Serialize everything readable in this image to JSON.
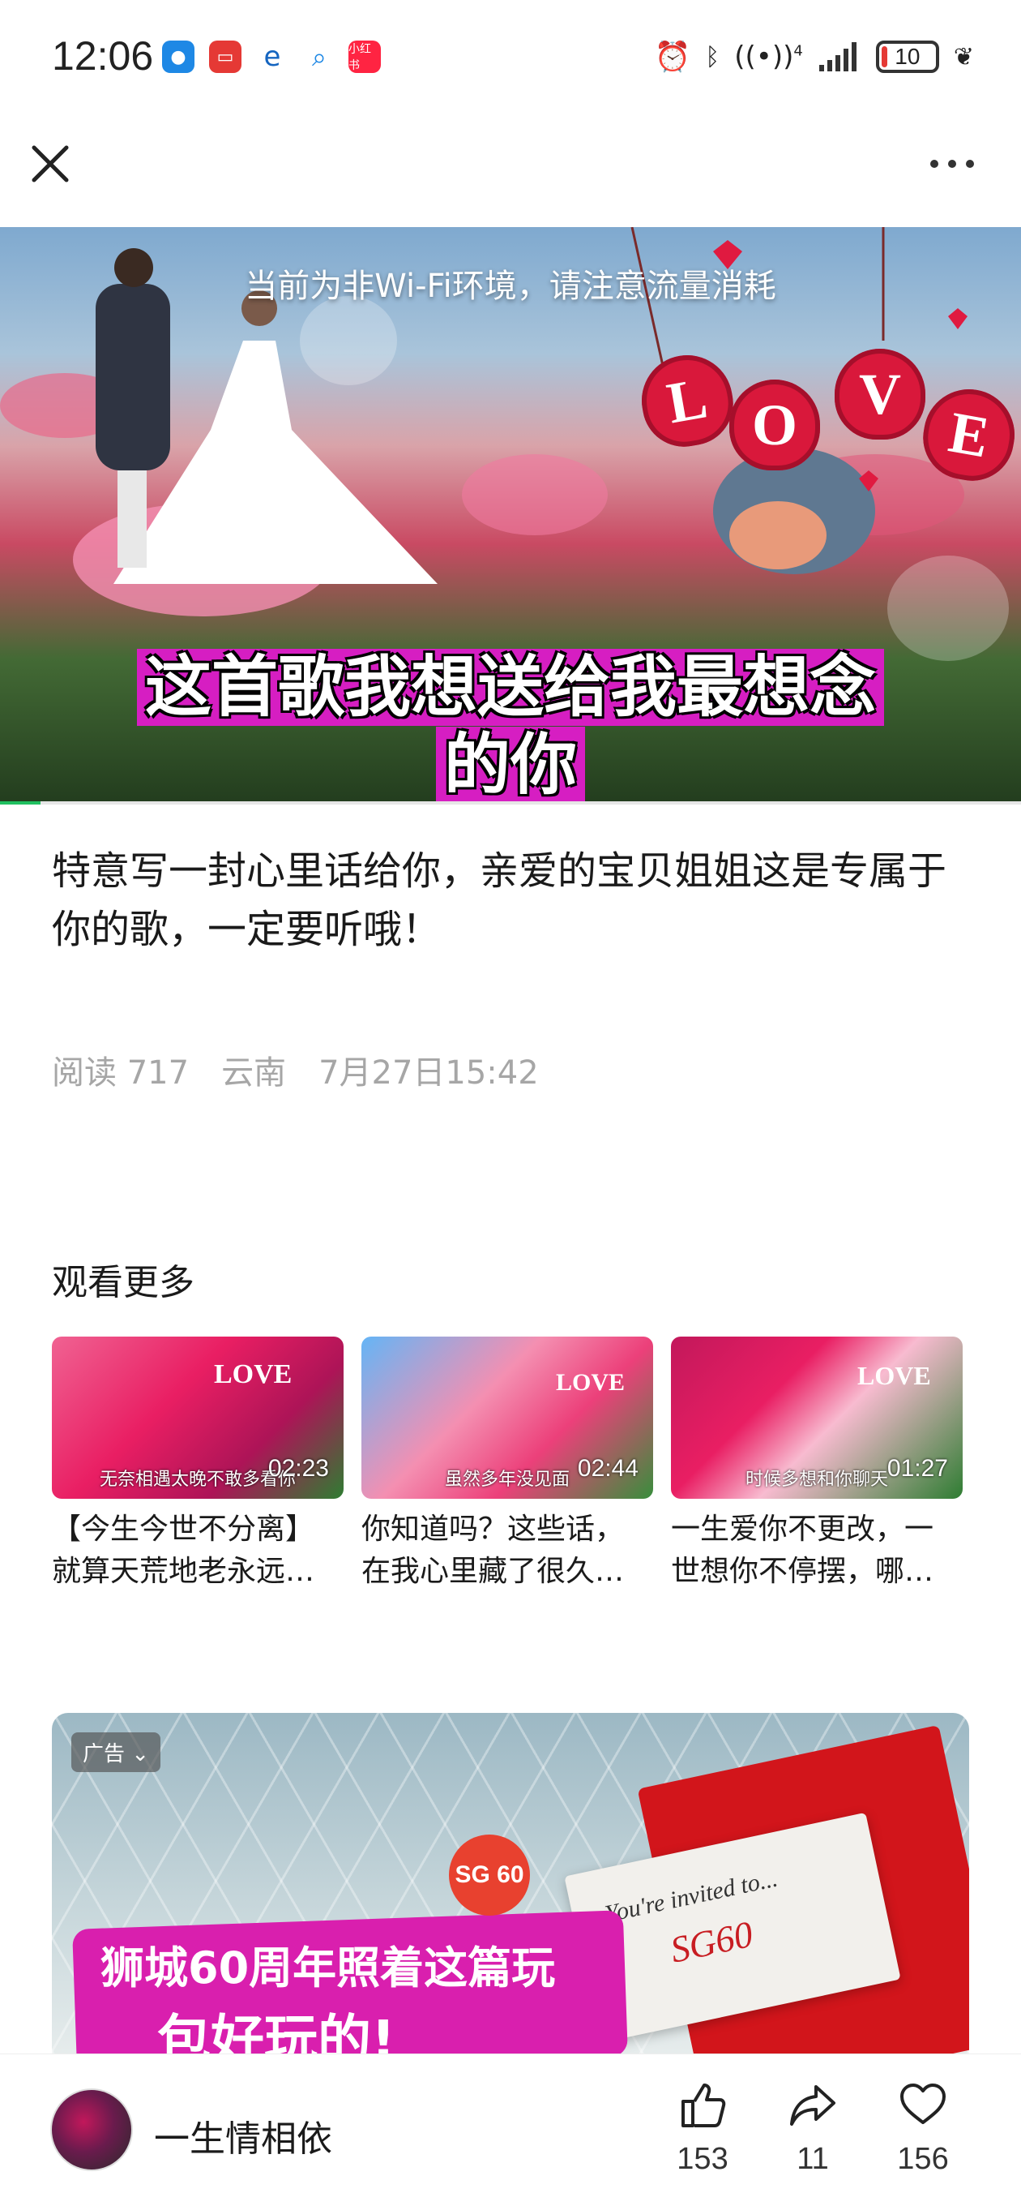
{
  "status_bar": {
    "time": "12:06",
    "app_icons": [
      "message-icon",
      "mail-icon",
      "browser-icon",
      "search-app-icon",
      "xiaohongshu-icon"
    ],
    "xiaohongshu_label": "小红书",
    "signal_label": "4",
    "battery": "10",
    "battery_percent": 10
  },
  "video": {
    "network_notice": "当前为非Wi-Fi环境，请注意流量消耗",
    "caption_line1": "这首歌我想送给我最想念",
    "caption_line2": "的你",
    "love_letters": [
      "L",
      "O",
      "V",
      "E"
    ],
    "progress": 0.04
  },
  "article": {
    "title": "特意写一封心里话给你，亲爱的宝贝姐姐这是专属于你的歌，一定要听哦！",
    "reads": "阅读 717",
    "location": "云南",
    "datetime": "7月27日15:42"
  },
  "more": {
    "heading": "观看更多",
    "items": [
      {
        "subtitle": "无奈相遇太晚不敢多看你",
        "duration": "02:23",
        "title_line1": "【今生今世不分离】",
        "title_line2": "就算天荒地老永远…"
      },
      {
        "subtitle": "虽然多年没见面",
        "duration": "02:44",
        "title_line1": "你知道吗？这些话，",
        "title_line2": "在我心里藏了很久…"
      },
      {
        "subtitle": "时候多想和你聊天",
        "duration": "01:27",
        "title_line1": "一生爱你不更改，一",
        "title_line2": "世想你不停摆，哪…"
      }
    ]
  },
  "ad": {
    "badge": "广告",
    "logo": "SG 60",
    "headline": "狮城60周年照着这篇玩",
    "subline": "包好玩的!",
    "card_line1": "You're invited to...",
    "card_line2": "SG60"
  },
  "bottom": {
    "author": "一生情相依",
    "like_count": "153",
    "share_count": "11",
    "favorite_count": "156"
  }
}
